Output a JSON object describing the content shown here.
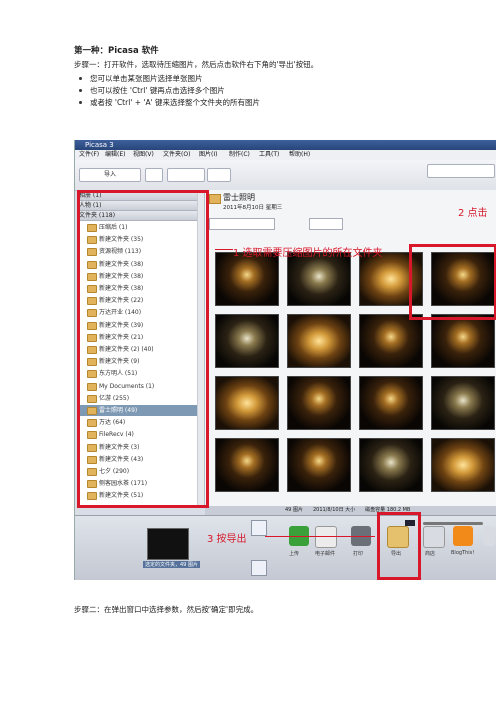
{
  "heading": "第一种：Picasa 软件",
  "step1": "步骤一：打开软件，选取待压缩图片，然后点击软件右下角的'导出'按钮。",
  "bullets": [
    "您可以单击某张图片选择单张图片",
    "也可以按住 'Ctrl' 键再点击选择多个图片",
    "或者按 'Ctrl' + 'A' 键来选择整个文件夹的所有图片"
  ],
  "step2": "步骤二：在弹出窗口中选择参数，然后按'确定'即完成。",
  "picasa": {
    "title": "Picasa 3",
    "menu": [
      "文件(F)",
      "编辑(E)",
      "视图(V)",
      "文件夹(O)",
      "图片(I)",
      "制作(C)",
      "工具(T)",
      "帮助(H)"
    ],
    "import_label": "导入",
    "sections": [
      "相册 (1)",
      "人物 (1)",
      "文件夹 (118)"
    ],
    "folders": [
      "压缩后 (1)",
      "新建文件夹 (35)",
      "资源视频 (113)",
      "新建文件夹 (38)",
      "新建文件夹 (38)",
      "新建文件夹 (38)",
      "新建文件夹 (22)",
      "万达开业 (140)",
      "新建文件夹 (39)",
      "新建文件夹 (21)",
      "新建文件夹 (2) (40)",
      "新建文件夹 (9)",
      "东方明人 (51)",
      "My Documents (1)",
      "亿游 (255)",
      "雷士照明 (49)",
      "万达 (64)",
      "FileRecv (4)",
      "新建文件夹 (3)",
      "新建文件夹 (43)",
      "七夕 (290)",
      "侧客园水茶 (171)",
      "新建文件夹 (51)"
    ],
    "selected_folder_index": 15,
    "folder_name": "雷士照明",
    "folder_date": "2011年8月10日 星期三",
    "status_text": "49 图片　　2011/8/10日 大小　　磁盘容量 180.2 MB",
    "tray_label": "选定的文件夹，49 图片",
    "bottom_buttons": [
      "上传",
      "电子邮件",
      "打印",
      "导出",
      "商店",
      "BlogThis!"
    ],
    "annotations": {
      "a1": "1 选取需要压缩图片的所在文件夹",
      "a2": "2  点击",
      "a3": "3  按导出"
    }
  }
}
